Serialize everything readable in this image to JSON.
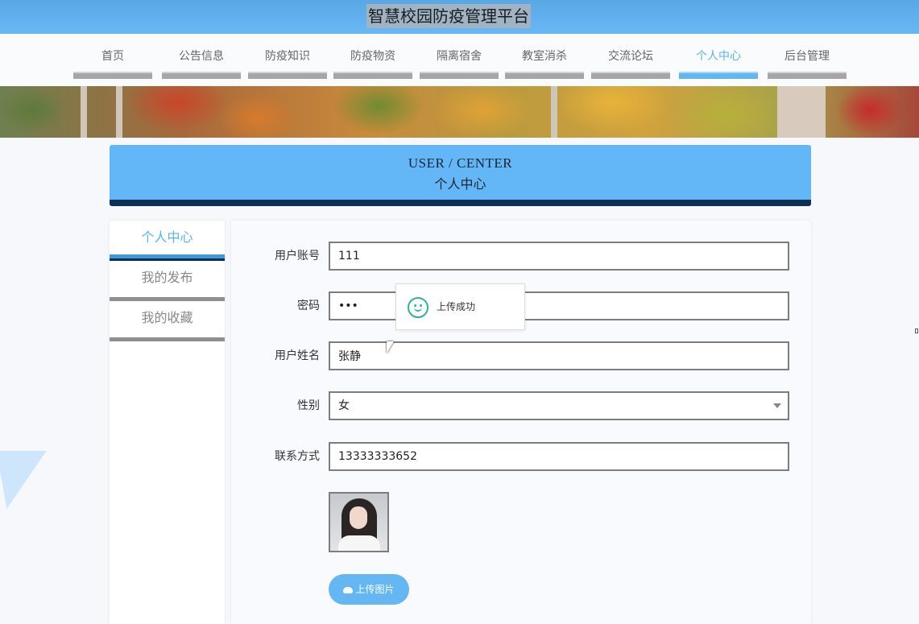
{
  "site": {
    "title": "智慧校园防疫管理平台"
  },
  "nav": {
    "items": [
      {
        "label": "首页"
      },
      {
        "label": "公告信息"
      },
      {
        "label": "防疫知识"
      },
      {
        "label": "防疫物资"
      },
      {
        "label": "隔离宿舍"
      },
      {
        "label": "教室消杀"
      },
      {
        "label": "交流论坛"
      },
      {
        "label": "个人中心"
      },
      {
        "label": "后台管理"
      }
    ],
    "active": "个人中心"
  },
  "header": {
    "title_en": "USER / CENTER",
    "title_zh": "个人中心"
  },
  "sidebar": {
    "items": [
      {
        "label": "个人中心"
      },
      {
        "label": "我的发布"
      },
      {
        "label": "我的收藏"
      }
    ],
    "active": "个人中心"
  },
  "form": {
    "account": {
      "label": "用户账号",
      "value": "111"
    },
    "password": {
      "label": "密码",
      "value": "•••"
    },
    "name": {
      "label": "用户姓名",
      "value": "张静"
    },
    "gender": {
      "label": "性别",
      "value": "女"
    },
    "phone": {
      "label": "联系方式",
      "value": "13333333652"
    },
    "upload_button": "上传图片"
  },
  "toast": {
    "message": "上传成功",
    "icon": "smile-icon",
    "color": "#2db68c"
  },
  "colors": {
    "accent": "#64b7f6",
    "dark": "#0e2f55"
  }
}
